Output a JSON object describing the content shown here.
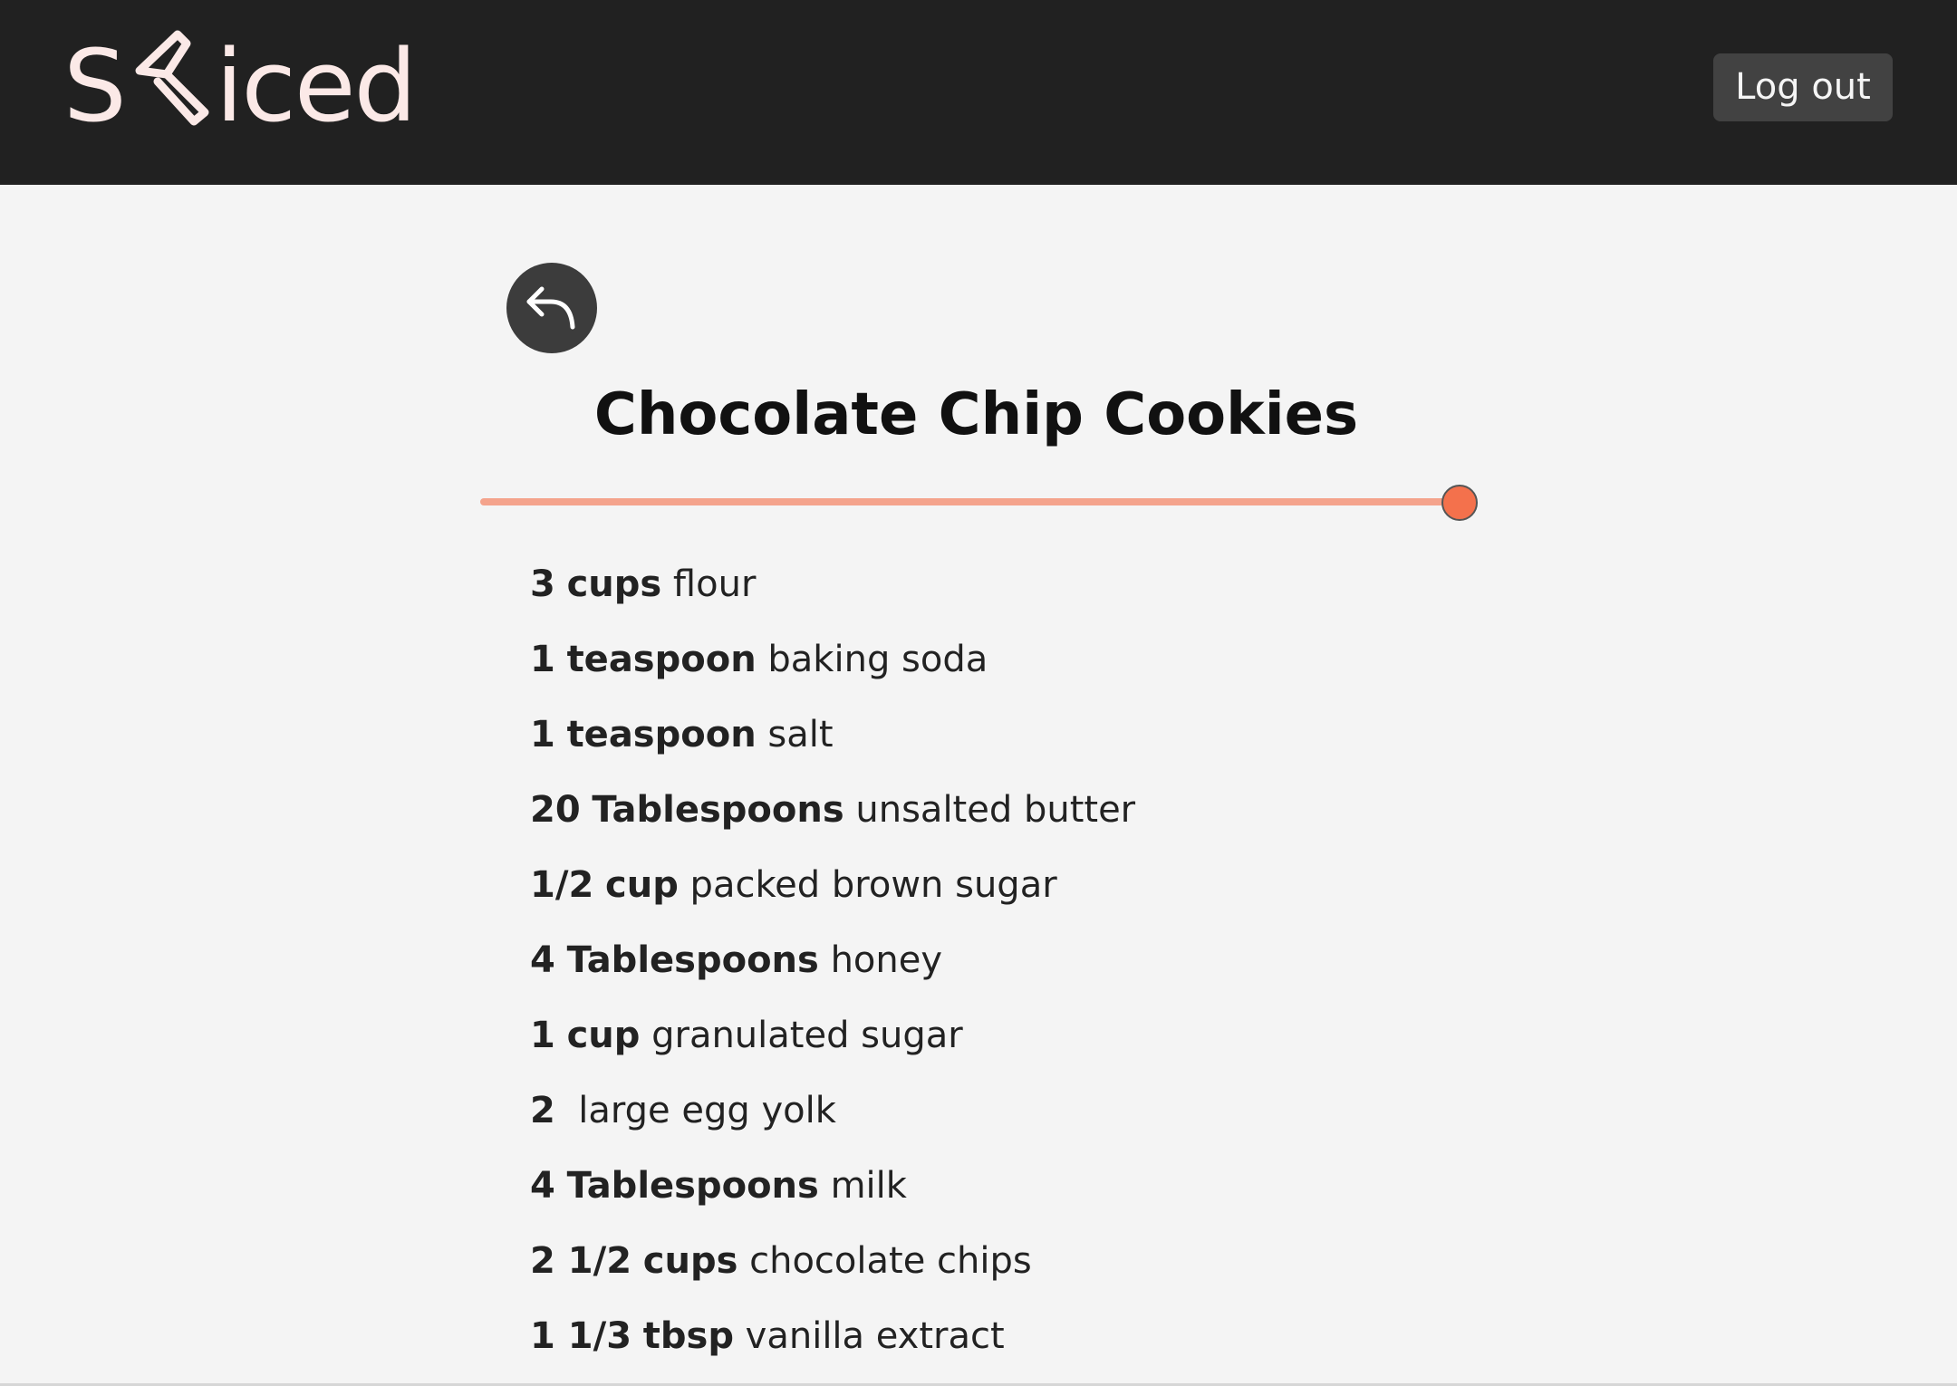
{
  "app": {
    "brand": "Sliced",
    "brand_prefix": "S",
    "brand_suffix": "iced",
    "logout_label": "Log out"
  },
  "colors": {
    "topbar": "#212121",
    "background": "#f4f4f4",
    "logo": "#fbe9e7",
    "accent": "#f4714c",
    "track": "#f4a38c"
  },
  "icons": {
    "logo_mark": "knife-icon",
    "back": "reply-arrow-icon"
  },
  "recipe": {
    "title": "Chocolate Chip Cookies",
    "scale_slider": {
      "fraction": 1.0
    },
    "ingredients": [
      {
        "qty": "3",
        "unit": "cups",
        "name": "flour"
      },
      {
        "qty": "1",
        "unit": "teaspoon",
        "name": "baking soda"
      },
      {
        "qty": "1",
        "unit": "teaspoon",
        "name": "salt"
      },
      {
        "qty": "20",
        "unit": "Tablespoons",
        "name": "unsalted butter"
      },
      {
        "qty": "1/2",
        "unit": "cup",
        "name": "packed brown sugar"
      },
      {
        "qty": "4",
        "unit": "Tablespoons",
        "name": "honey"
      },
      {
        "qty": "1",
        "unit": "cup",
        "name": "granulated sugar"
      },
      {
        "qty": "2",
        "unit": "",
        "name": "large egg yolk"
      },
      {
        "qty": "4",
        "unit": "Tablespoons",
        "name": "milk"
      },
      {
        "qty": "2 1/2",
        "unit": "cups",
        "name": "chocolate chips"
      },
      {
        "qty": "1 1/3",
        "unit": "tbsp",
        "name": "vanilla extract"
      }
    ]
  }
}
